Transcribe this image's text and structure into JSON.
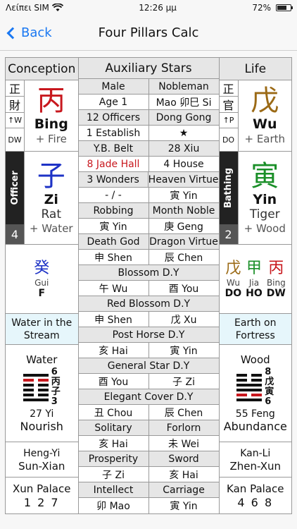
{
  "status": {
    "carrier": "Λείπει SIM",
    "time": "12:26 μμ",
    "battery": "72%",
    "battery_level": 0.72
  },
  "nav": {
    "back_label": "Back",
    "title": "Four Pillars Calc"
  },
  "columns": {
    "left": "Conception",
    "middle": "Auxiliary Stars",
    "right": "Life"
  },
  "colors": {
    "red": "#c8181e",
    "blue": "#1e33c6",
    "green": "#1a8f28",
    "brown": "#9b6a16",
    "nayin_bg": "#e6f6fb"
  },
  "left": {
    "branch_tags": [
      "正",
      "財",
      "↑W",
      "DW"
    ],
    "stem_char": "丙",
    "stem_pinyin": "Bing",
    "stem_sub": "+ Fire",
    "god_label": "Officer",
    "god_num": "4",
    "branch_char": "子",
    "branch_pinyin": "Zi",
    "branch_animal": "Rat",
    "branch_sub": "+ Water",
    "hidden": [
      {
        "char": "癸",
        "py": "Gui",
        "code": "F"
      }
    ],
    "nayin": "Water in the Stream",
    "hex_element": "Water",
    "hex_side": [
      "6",
      "丙",
      "子",
      "3"
    ],
    "hex_num": "27 Yi",
    "hex_name": "Nourish",
    "trigram_line1": "Heng-Yi",
    "trigram_line2": "Sun-Xian",
    "palace_name": "Xun Palace",
    "palace_nums": "1 2 7"
  },
  "right": {
    "branch_tags": [
      "正",
      "官",
      "↑P",
      "DO"
    ],
    "stem_char": "戊",
    "stem_pinyin": "Wu",
    "stem_sub": "+ Earth",
    "god_label": "Bathing",
    "god_num": "2",
    "branch_char": "寅",
    "branch_pinyin": "Yin",
    "branch_animal": "Tiger",
    "branch_sub": "+ Wood",
    "hidden": [
      {
        "char": "戊",
        "py": "Wu",
        "code": "DO"
      },
      {
        "char": "甲",
        "py": "Jia",
        "code": "HO"
      },
      {
        "char": "丙",
        "py": "Bing",
        "code": "DW"
      }
    ],
    "nayin": "Earth on Fortress",
    "hex_element": "Wood",
    "hex_side": [
      "8",
      "戊",
      "寅",
      "6"
    ],
    "hex_num": "55 Feng",
    "hex_name": "Abundance",
    "trigram_line1": "Kan-Li",
    "trigram_line2": "Zhen-Xun",
    "palace_name": "Kan Palace",
    "palace_nums": "4 6 8"
  },
  "stars": [
    {
      "hdr": true,
      "a": "Male",
      "b": "Nobleman"
    },
    {
      "a": "Age 1",
      "b": "Mao 卯巳 Si"
    },
    {
      "hdr": true,
      "a": "12 Officers",
      "b": "Dong Gong"
    },
    {
      "a": "1 Establish",
      "b": "★"
    },
    {
      "hdr": true,
      "a": "Y.B. Belt",
      "b": "28 Xiu"
    },
    {
      "a": "8 Jade Hall",
      "b": "4 House",
      "red_a": true
    },
    {
      "hdr": true,
      "a": "3 Wonders",
      "b": "Heaven Virtue"
    },
    {
      "a": "- / -",
      "b": "寅 Yin"
    },
    {
      "hdr": true,
      "a": "Robbing",
      "b": "Month Noble"
    },
    {
      "a": "寅 Yin",
      "b": "庚 Geng"
    },
    {
      "hdr": true,
      "a": "Death God",
      "b": "Dragon Virtue"
    },
    {
      "a": "申 Shen",
      "b": "辰 Chen"
    },
    {
      "hdr": true,
      "single": "Blossom D.Y"
    },
    {
      "a": "午 Wu",
      "b": "酉 You"
    },
    {
      "hdr": true,
      "single": "Red Blossom D.Y"
    },
    {
      "a": "申 Shen",
      "b": "戊 Xu"
    },
    {
      "hdr": true,
      "single": "Post Horse D.Y"
    },
    {
      "a": "亥 Hai",
      "b": "寅 Yin"
    },
    {
      "hdr": true,
      "single": "General Star D.Y"
    },
    {
      "a": "酉 You",
      "b": "子 Zi"
    },
    {
      "hdr": true,
      "single": "Elegant Cover D.Y"
    },
    {
      "a": "丑 Chou",
      "b": "辰 Chen"
    },
    {
      "hdr": true,
      "a": "Solitary",
      "b": "Forlorn"
    },
    {
      "a": "亥 Hai",
      "b": "未 Wei"
    },
    {
      "hdr": true,
      "a": "Prosperity",
      "b": "Sword"
    },
    {
      "a": "子 Zi",
      "b": "亥 Hai"
    },
    {
      "hdr": true,
      "a": "Intellect",
      "b": "Carriage"
    },
    {
      "a": "卯 Mao",
      "b": "寅 Yin"
    }
  ]
}
